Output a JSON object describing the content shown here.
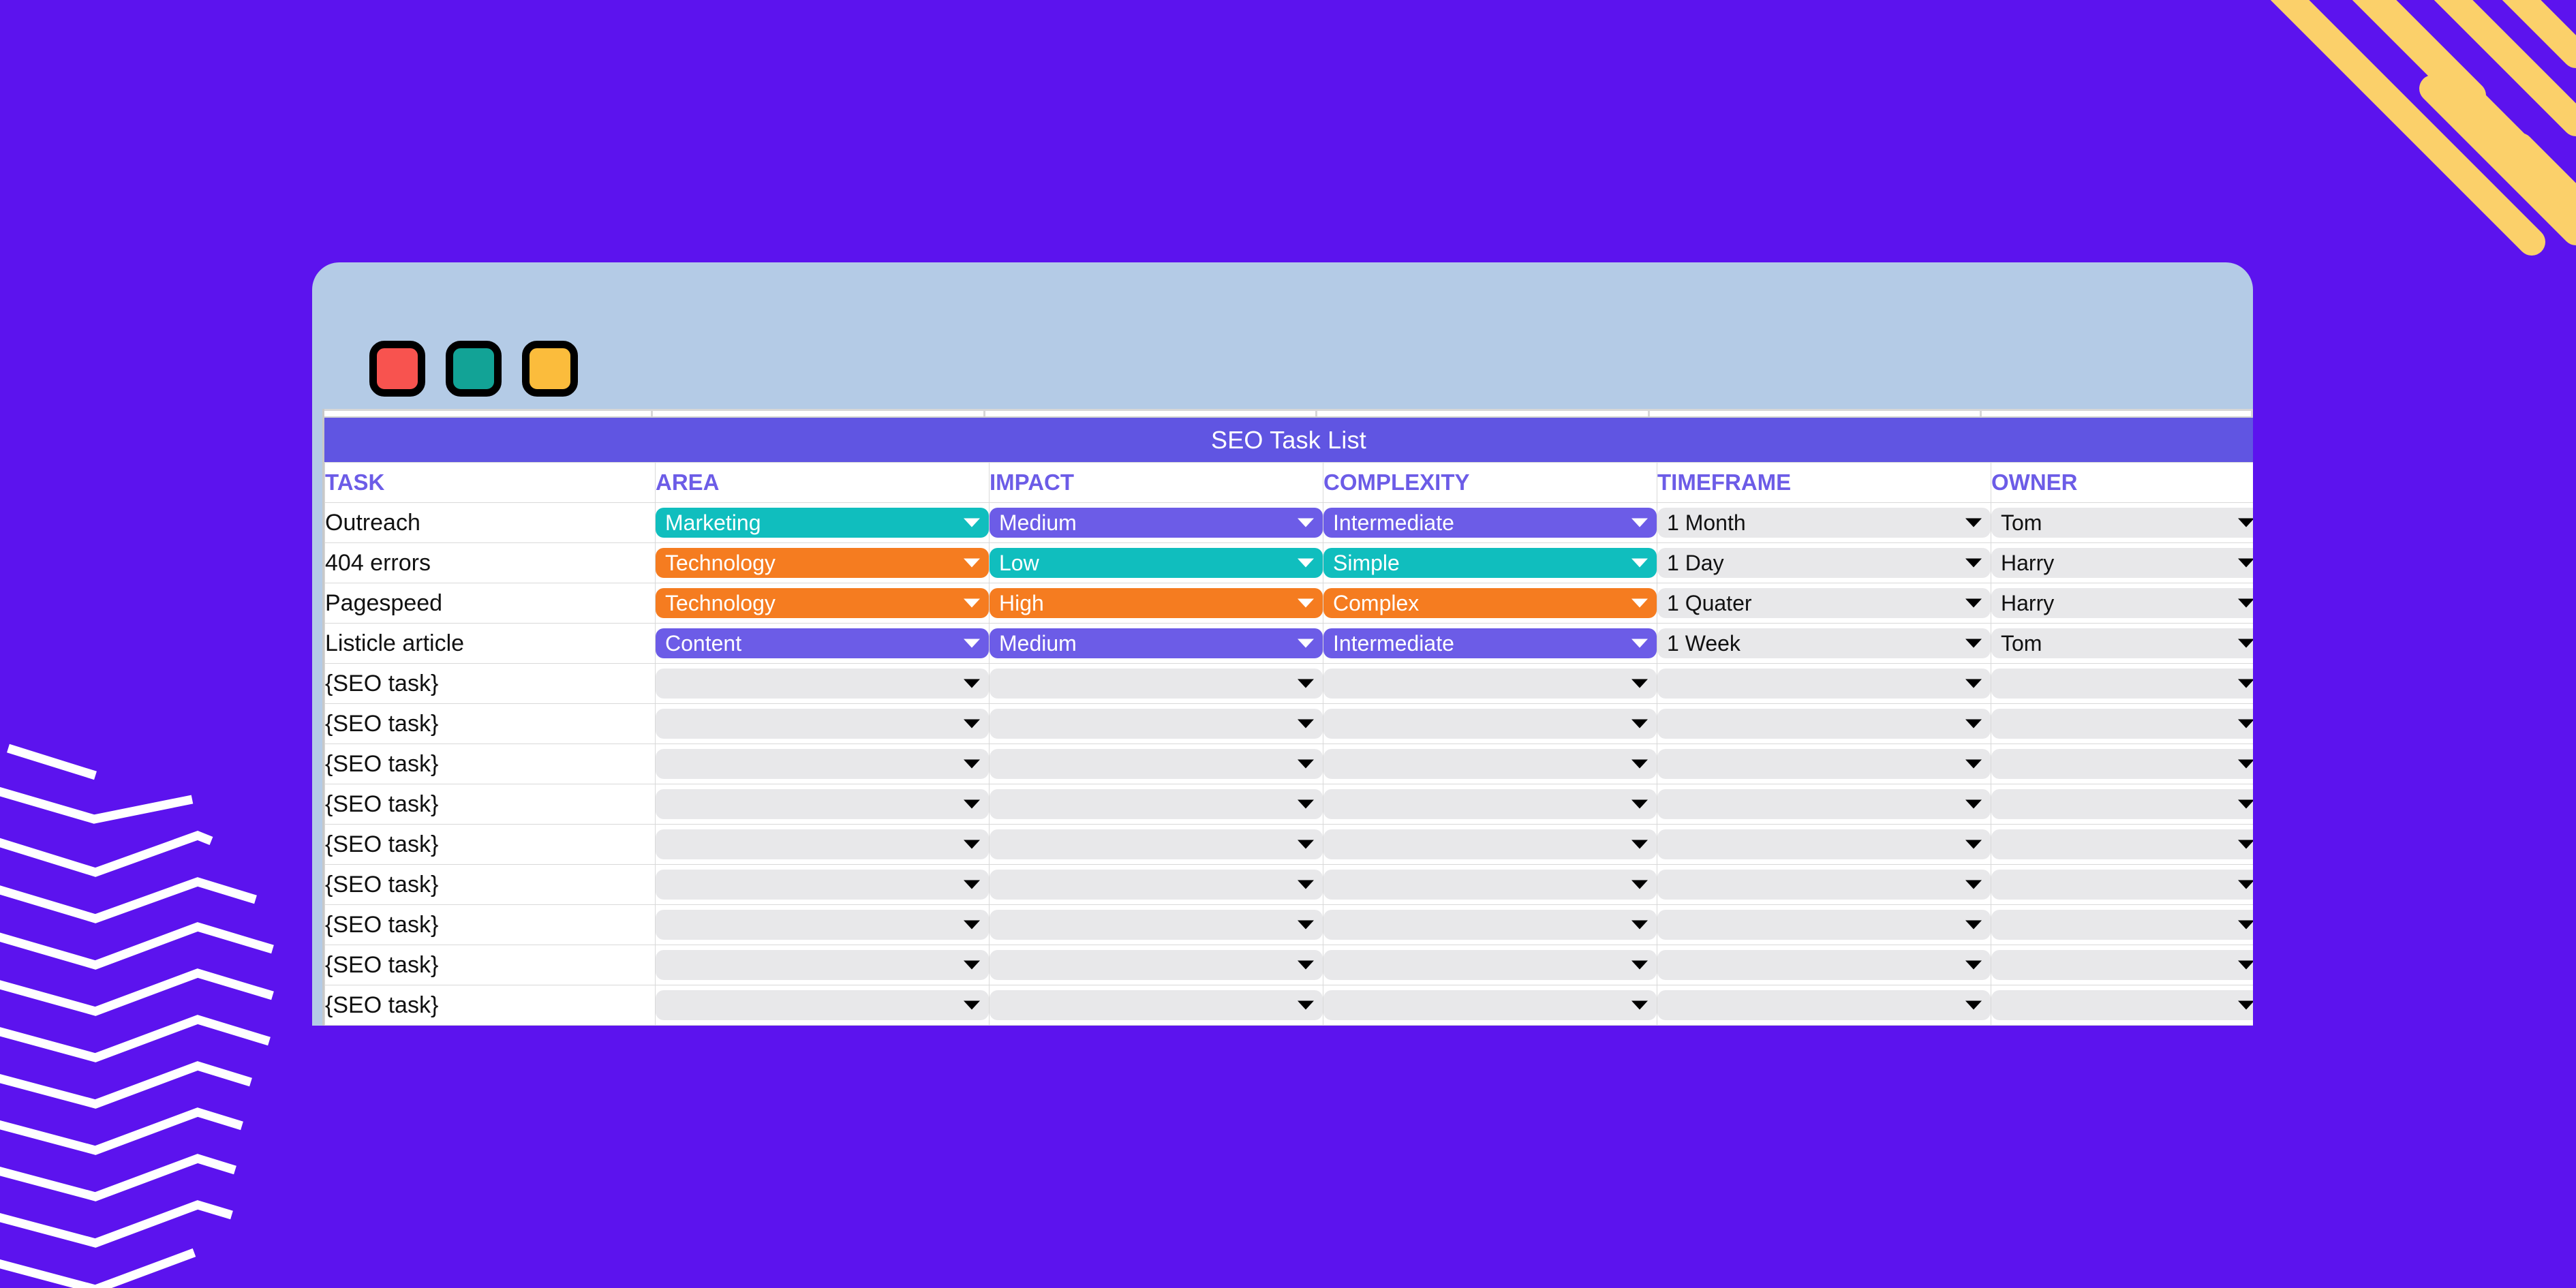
{
  "theme": {
    "background": "#5C13EE",
    "window_chrome": "#B4CBE6",
    "accent_purple": "#6C5CE7",
    "title_band": "#6055E2",
    "teal": "#10BEBE",
    "orange": "#F57C20",
    "grey_field": "#E8E8EA",
    "stripe_yellow": "#FBD06A",
    "chevron_white": "#FFFFFF"
  },
  "window": {
    "traffic_lights": [
      {
        "name": "close",
        "color": "#F8534F"
      },
      {
        "name": "minimize",
        "color": "#12A396"
      },
      {
        "name": "maximize",
        "color": "#FBBC3C"
      }
    ]
  },
  "sheet": {
    "title": "SEO Task List",
    "columns": [
      "TASK",
      "AREA",
      "IMPACT",
      "COMPLEXITY",
      "TIMEFRAME",
      "OWNER"
    ],
    "placeholder_task": "{SEO task}",
    "rows": [
      {
        "task": "Outreach",
        "area": {
          "value": "Marketing",
          "color": "teal"
        },
        "impact": {
          "value": "Medium",
          "color": "purple"
        },
        "complexity": {
          "value": "Intermediate",
          "color": "purple"
        },
        "timeframe": {
          "value": "1 Month",
          "color": "grey"
        },
        "owner": {
          "value": "Tom",
          "color": "grey"
        }
      },
      {
        "task": "404 errors",
        "area": {
          "value": "Technology",
          "color": "orange"
        },
        "impact": {
          "value": "Low",
          "color": "teal"
        },
        "complexity": {
          "value": "Simple",
          "color": "teal"
        },
        "timeframe": {
          "value": "1 Day",
          "color": "grey"
        },
        "owner": {
          "value": "Harry",
          "color": "grey"
        }
      },
      {
        "task": "Pagespeed",
        "area": {
          "value": "Technology",
          "color": "orange"
        },
        "impact": {
          "value": "High",
          "color": "orange"
        },
        "complexity": {
          "value": "Complex",
          "color": "orange"
        },
        "timeframe": {
          "value": "1 Quater",
          "color": "grey"
        },
        "owner": {
          "value": "Harry",
          "color": "grey"
        }
      },
      {
        "task": "Listicle article",
        "area": {
          "value": "Content",
          "color": "purple"
        },
        "impact": {
          "value": "Medium",
          "color": "purple"
        },
        "complexity": {
          "value": "Intermediate",
          "color": "purple"
        },
        "timeframe": {
          "value": "1 Week",
          "color": "grey"
        },
        "owner": {
          "value": "Tom",
          "color": "grey"
        }
      },
      {
        "task": "{SEO task}",
        "area": {
          "value": "",
          "color": "empty"
        },
        "impact": {
          "value": "",
          "color": "empty"
        },
        "complexity": {
          "value": "",
          "color": "empty"
        },
        "timeframe": {
          "value": "",
          "color": "empty"
        },
        "owner": {
          "value": "",
          "color": "empty"
        }
      },
      {
        "task": "{SEO task}",
        "area": {
          "value": "",
          "color": "empty"
        },
        "impact": {
          "value": "",
          "color": "empty"
        },
        "complexity": {
          "value": "",
          "color": "empty"
        },
        "timeframe": {
          "value": "",
          "color": "empty"
        },
        "owner": {
          "value": "",
          "color": "empty"
        }
      },
      {
        "task": "{SEO task}",
        "area": {
          "value": "",
          "color": "empty"
        },
        "impact": {
          "value": "",
          "color": "empty"
        },
        "complexity": {
          "value": "",
          "color": "empty"
        },
        "timeframe": {
          "value": "",
          "color": "empty"
        },
        "owner": {
          "value": "",
          "color": "empty"
        }
      },
      {
        "task": "{SEO task}",
        "area": {
          "value": "",
          "color": "empty"
        },
        "impact": {
          "value": "",
          "color": "empty"
        },
        "complexity": {
          "value": "",
          "color": "empty"
        },
        "timeframe": {
          "value": "",
          "color": "empty"
        },
        "owner": {
          "value": "",
          "color": "empty"
        }
      },
      {
        "task": "{SEO task}",
        "area": {
          "value": "",
          "color": "empty"
        },
        "impact": {
          "value": "",
          "color": "empty"
        },
        "complexity": {
          "value": "",
          "color": "empty"
        },
        "timeframe": {
          "value": "",
          "color": "empty"
        },
        "owner": {
          "value": "",
          "color": "empty"
        }
      },
      {
        "task": "{SEO task}",
        "area": {
          "value": "",
          "color": "empty"
        },
        "impact": {
          "value": "",
          "color": "empty"
        },
        "complexity": {
          "value": "",
          "color": "empty"
        },
        "timeframe": {
          "value": "",
          "color": "empty"
        },
        "owner": {
          "value": "",
          "color": "empty"
        }
      },
      {
        "task": "{SEO task}",
        "area": {
          "value": "",
          "color": "empty"
        },
        "impact": {
          "value": "",
          "color": "empty"
        },
        "complexity": {
          "value": "",
          "color": "empty"
        },
        "timeframe": {
          "value": "",
          "color": "empty"
        },
        "owner": {
          "value": "",
          "color": "empty"
        }
      },
      {
        "task": "{SEO task}",
        "area": {
          "value": "",
          "color": "empty"
        },
        "impact": {
          "value": "",
          "color": "empty"
        },
        "complexity": {
          "value": "",
          "color": "empty"
        },
        "timeframe": {
          "value": "",
          "color": "empty"
        },
        "owner": {
          "value": "",
          "color": "empty"
        }
      },
      {
        "task": "{SEO task}",
        "area": {
          "value": "",
          "color": "empty"
        },
        "impact": {
          "value": "",
          "color": "empty"
        },
        "complexity": {
          "value": "",
          "color": "empty"
        },
        "timeframe": {
          "value": "",
          "color": "empty"
        },
        "owner": {
          "value": "",
          "color": "empty"
        }
      }
    ]
  }
}
